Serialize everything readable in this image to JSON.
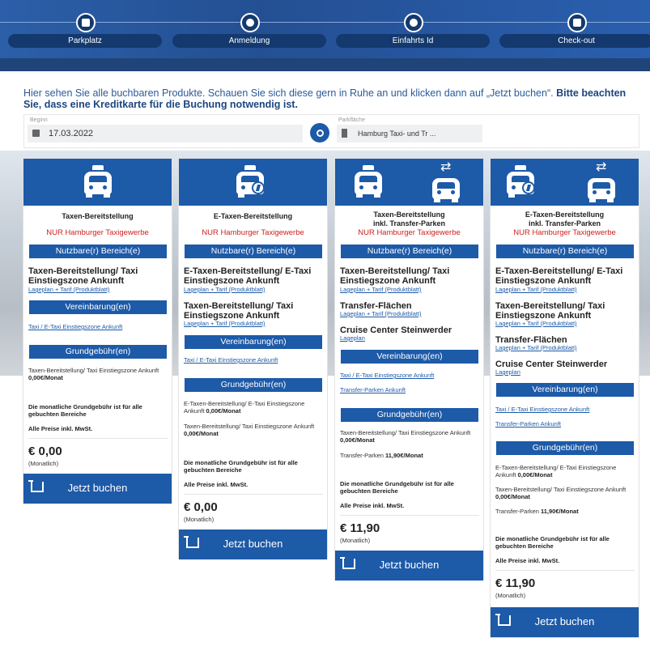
{
  "stepper": [
    {
      "label": "Parkplatz",
      "icon": "calendar-icon"
    },
    {
      "label": "Anmeldung",
      "icon": "user-icon"
    },
    {
      "label": "Einfahrts Id",
      "icon": "key-icon"
    },
    {
      "label": "Check-out",
      "icon": "basket-icon"
    }
  ],
  "intro": {
    "text": "Hier sehen Sie alle buchbaren Produkte. Schauen Sie sich diese gern in Ruhe an und klicken dann auf „Jetzt buchen“. ",
    "bold": "Bitte beachten Sie, dass eine Kreditkarte für die Buchung notwendig ist."
  },
  "search": {
    "begin_label": "Beginn",
    "begin_value": "17.03.2022",
    "lot_label": "Parkfläche",
    "lot_value": "Hamburg Taxi- und Tr ..."
  },
  "cards": [
    {
      "title": "Taxen-Bereitstellung",
      "title2": "",
      "subtitle": "NUR Hamburger Taxigewerbe",
      "areas_header": "Nutzbare(r) Bereich(e)",
      "areas": [
        {
          "name": "Taxen-Bereitstellung/ Taxi Einstiegszone Ankunft",
          "link": "Lageplan + Tarif (Produktblatt)"
        }
      ],
      "agreements_header": "Vereinbarung(en)",
      "agreements": [
        "Taxi / E-Taxi Einstiegszone Ankunft"
      ],
      "fees_header": "Grundgebühr(en)",
      "fees": [
        {
          "text": "Taxen-Bereitstellung/ Taxi Einstiegszone Ankunft ",
          "amount": "0,00€/Monat"
        }
      ],
      "note": "Die monatliche Grundgebühr ist für alle gebuchten Bereiche",
      "vat": "Alle Preise inkl. MwSt.",
      "price": "€ 0,00",
      "period": "(Monatlich)",
      "button": "Jetzt buchen"
    },
    {
      "title": "E-Taxen-Bereitstellung",
      "title2": "",
      "subtitle": "NUR Hamburger Taxigewerbe",
      "areas_header": "Nutzbare(r) Bereich(e)",
      "areas": [
        {
          "name": "E-Taxen-Bereitstellung/ E-Taxi Einstiegszone Ankunft",
          "link": "Lageplan + Tarif (Produktblatt)"
        },
        {
          "name": "Taxen-Bereitstellung/ Taxi Einstiegszone Ankunft",
          "link": "Lageplan + Tarif (Produktblatt)"
        }
      ],
      "agreements_header": "Vereinbarung(en)",
      "agreements": [
        "Taxi / E-Taxi Einstiegszone Ankunft"
      ],
      "fees_header": "Grundgebühr(en)",
      "fees": [
        {
          "text": "E-Taxen-Bereitstellung/ E-Taxi Einstiegszone Ankunft ",
          "amount": "0,00€/Monat"
        },
        {
          "text": "Taxen-Bereitstellung/ Taxi Einstiegszone Ankunft ",
          "amount": "0,00€/Monat"
        }
      ],
      "note": "Die monatliche Grundgebühr ist für alle gebuchten Bereiche",
      "vat": "Alle Preise inkl. MwSt.",
      "price": "€ 0,00",
      "period": "(Monatlich)",
      "button": "Jetzt buchen"
    },
    {
      "title": "Taxen-Bereitstellung",
      "title2": "inkl. Transfer-Parken",
      "subtitle": "NUR Hamburger Taxigewerbe",
      "areas_header": "Nutzbare(r) Bereich(e)",
      "areas": [
        {
          "name": "Taxen-Bereitstellung/ Taxi Einstiegszone Ankunft",
          "link": "Lageplan + Tarif (Produktblatt)"
        },
        {
          "name": "Transfer-Flächen",
          "link": "Lageplan + Tarif (Produktblatt)"
        },
        {
          "name": "Cruise Center Steinwerder",
          "link": "Lageplan"
        }
      ],
      "agreements_header": "Vereinbarung(en)",
      "agreements": [
        "Taxi / E-Taxi Einstiegszone Ankunft",
        "Transfer-Parken Ankunft"
      ],
      "fees_header": "Grundgebühr(en)",
      "fees": [
        {
          "text": "Taxen-Bereitstellung/ Taxi Einstiegszone Ankunft ",
          "amount": "0,00€/Monat"
        },
        {
          "text": "Transfer-Parken ",
          "amount": "11,90€/Monat"
        }
      ],
      "note": "Die monatliche Grundgebühr ist für alle gebuchten Bereiche",
      "vat": "Alle Preise inkl. MwSt.",
      "price": "€ 11,90",
      "period": "(Monatlich)",
      "button": "Jetzt buchen"
    },
    {
      "title": "E-Taxen-Bereitstellung",
      "title2": "inkl. Transfer-Parken",
      "subtitle": "NUR Hamburger Taxigewerbe",
      "areas_header": "Nutzbare(r) Bereich(e)",
      "areas": [
        {
          "name": "E-Taxen-Bereitstellung/ E-Taxi Einstiegszone Ankunft",
          "link": "Lageplan + Tarif (Produktblatt)"
        },
        {
          "name": "Taxen-Bereitstellung/ Taxi Einstiegszone Ankunft",
          "link": "Lageplan + Tarif (Produktblatt)"
        },
        {
          "name": "Transfer-Flächen",
          "link": "Lageplan + Tarif (Produktblatt)"
        },
        {
          "name": "Cruise Center Steinwerder",
          "link": "Lageplan"
        }
      ],
      "agreements_header": "Vereinbarung(en)",
      "agreements": [
        "Taxi / E-Taxi Einstiegszone Ankunft",
        "Transfer-Parken Ankunft"
      ],
      "fees_header": "Grundgebühr(en)",
      "fees": [
        {
          "text": "E-Taxen-Bereitstellung/ E-Taxi Einstiegszone Ankunft ",
          "amount": "0,00€/Monat"
        },
        {
          "text": "Taxen-Bereitstellung/ Taxi Einstiegszone Ankunft ",
          "amount": "0,00€/Monat"
        },
        {
          "text": "Transfer-Parken ",
          "amount": "11,90€/Monat"
        }
      ],
      "note": "Die monatliche Grundgebühr ist für alle gebuchten Bereiche",
      "vat": "Alle Preise inkl. MwSt.",
      "price": "€ 11,90",
      "period": "(Monatlich)",
      "button": "Jetzt buchen"
    }
  ]
}
